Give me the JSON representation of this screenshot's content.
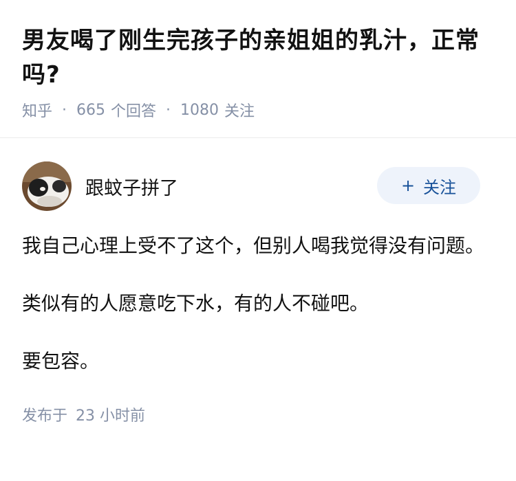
{
  "question": {
    "title": "男友喝了刚生完孩子的亲姐姐的乳汁，正常吗?",
    "source": "知乎",
    "answer_count": "665",
    "answer_label": "个回答",
    "follow_count": "1080",
    "follow_label": "关注"
  },
  "answer": {
    "author_name": "跟蚊子拼了",
    "avatar_icon": "cat-avatar",
    "follow_button": {
      "plus": "+",
      "label": "关注"
    },
    "paragraphs": [
      "我自己心理上受不了这个，但别人喝我觉得没有问题。",
      "类似有的人愿意吃下水，有的人不碰吧。",
      "要包容。"
    ],
    "published_label": "发布于",
    "published_time": "23 小时前"
  },
  "colors": {
    "text": "#121212",
    "meta": "#8590a6",
    "accent": "#175199",
    "button_bg": "#eef3fb"
  }
}
